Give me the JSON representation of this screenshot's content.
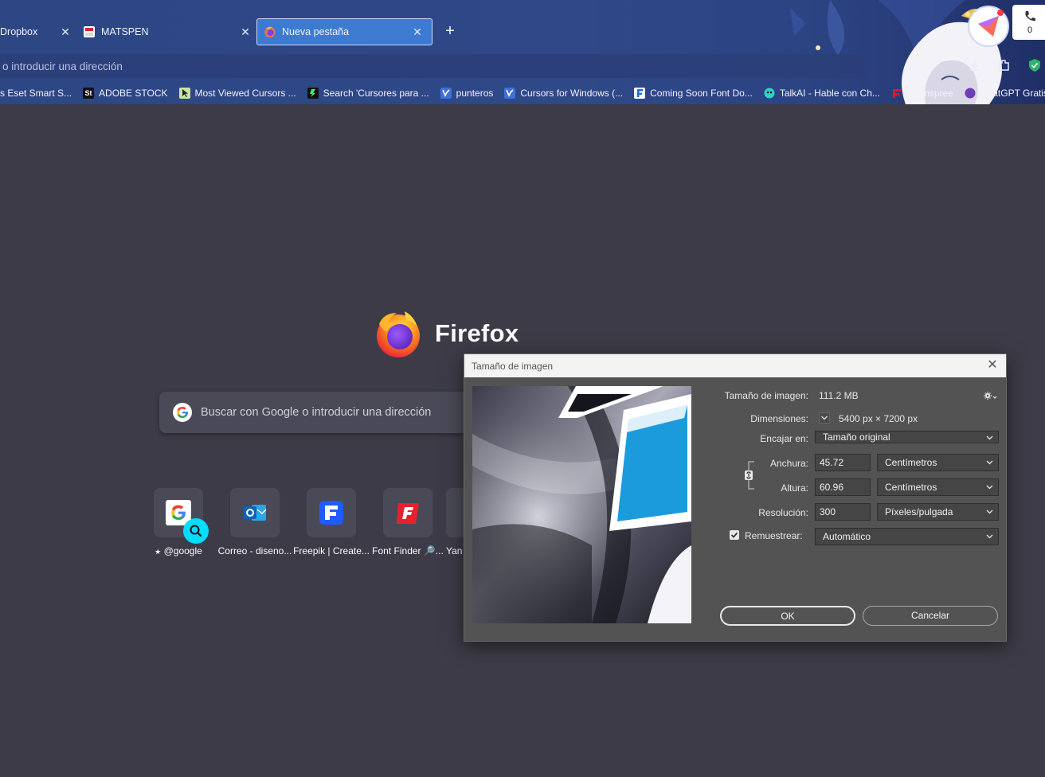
{
  "browser": {
    "tabs": [
      {
        "label": "Dropbox",
        "close": "✕",
        "active": false
      },
      {
        "label": "MATSPEN",
        "close": "✕",
        "active": false
      },
      {
        "label": "Nueva pestaña",
        "close": "✕",
        "active": true
      }
    ],
    "new_tab": "+",
    "address_placeholder": "o introducir una dirección",
    "bookmarks": [
      {
        "label": "s Eset Smart S..."
      },
      {
        "label": "ADOBE STOCK",
        "icon_text": "St"
      },
      {
        "label": "Most Viewed Cursors ..."
      },
      {
        "label": "Search 'Cursores para ..."
      },
      {
        "label": "punteros"
      },
      {
        "label": "Cursors for Windows (..."
      },
      {
        "label": "Coming Soon Font Do..."
      },
      {
        "label": "TalkAI - Hable con Ch..."
      },
      {
        "label": "Formspree"
      },
      {
        "label": "ChatGPT Gratis Sin Re"
      }
    ],
    "call_count": "0"
  },
  "newtab": {
    "brand": "Firefox",
    "search_placeholder": "Buscar con Google o introducir una dirección",
    "shortcuts": [
      {
        "label": "@google",
        "pin": "★"
      },
      {
        "label": "Correo - diseno..."
      },
      {
        "label": "Freepik | Create..."
      },
      {
        "label": "Font Finder 🔎..."
      },
      {
        "label": "Yan"
      }
    ]
  },
  "dialog": {
    "title": "Tamaño de imagen",
    "close": "✕",
    "image_size_label": "Tamaño de imagen:",
    "image_size_value": "111.2 MB",
    "dimensions_label": "Dimensiones:",
    "dimensions_value": "5400 px × 7200 px",
    "fit_label": "Encajar en:",
    "fit_value": "Tamaño original",
    "width_label": "Anchura:",
    "width_value": "45.72",
    "width_unit": "Centímetros",
    "height_label": "Altura:",
    "height_value": "60.96",
    "height_unit": "Centímetros",
    "resolution_label": "Resolución:",
    "resolution_value": "300",
    "resolution_unit": "Píxeles/pulgada",
    "resample_label": "Remuestrear:",
    "resample_checked": true,
    "resample_value": "Automático",
    "ok_label": "OK",
    "cancel_label": "Cancelar"
  },
  "colors": {
    "chrome": "#2e4888",
    "active_tab": "#3d7bd2",
    "page_bg": "#3c3b47",
    "dialog_bg": "#535353",
    "accent_cyan": "#00ddff"
  }
}
